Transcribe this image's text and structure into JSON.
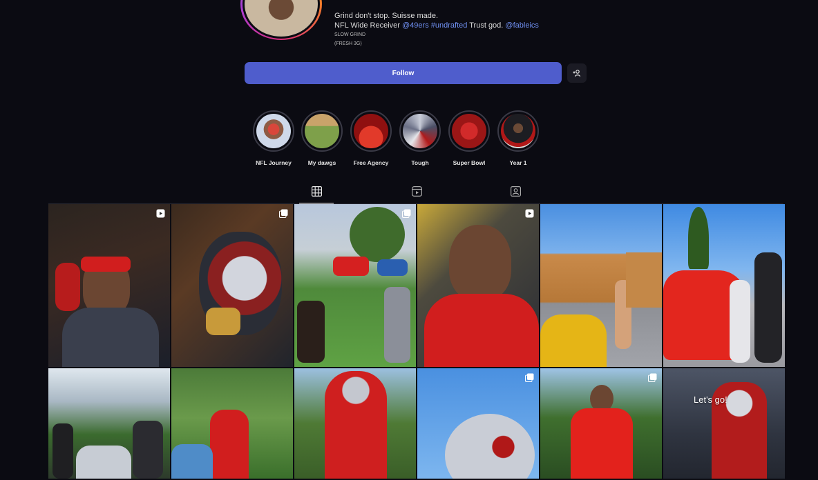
{
  "profile": {
    "bio_line1": "Grind don't stop. Suisse made.",
    "bio_line2_prefix": "NFL Wide Receiver",
    "bio_line2_tag1": "@49ers",
    "bio_line2_tag2": "#undrafted",
    "bio_line2_middle": "Trust god.",
    "bio_line2_tag3": "@fableics",
    "bio_line3": "SLOW GRIND",
    "bio_line4": "(FRESH 3G)"
  },
  "actions": {
    "follow_label": "Follow",
    "add_user_icon": "add-user-icon"
  },
  "highlights": [
    {
      "label": "NFL Journey",
      "color": "#d9463b"
    },
    {
      "label": "My dawgs",
      "color": "#7ea04a"
    },
    {
      "label": "Free Agency",
      "color": "#c21e1e"
    },
    {
      "label": "Tough",
      "color": "#6a6f86"
    },
    {
      "label": "Super Bowl",
      "color": "#9b1616"
    },
    {
      "label": "Year 1",
      "color": "#2a2a30"
    }
  ],
  "tabs": [
    {
      "icon": "grid-icon",
      "active": true
    },
    {
      "icon": "reels-icon",
      "active": false
    },
    {
      "icon": "tagged-icon",
      "active": false
    }
  ],
  "grid": {
    "overlay_text": "Let's go!"
  },
  "colors": {
    "background": "#0b0b12",
    "accent": "#4f5dcc",
    "link": "#6f8ff0"
  }
}
